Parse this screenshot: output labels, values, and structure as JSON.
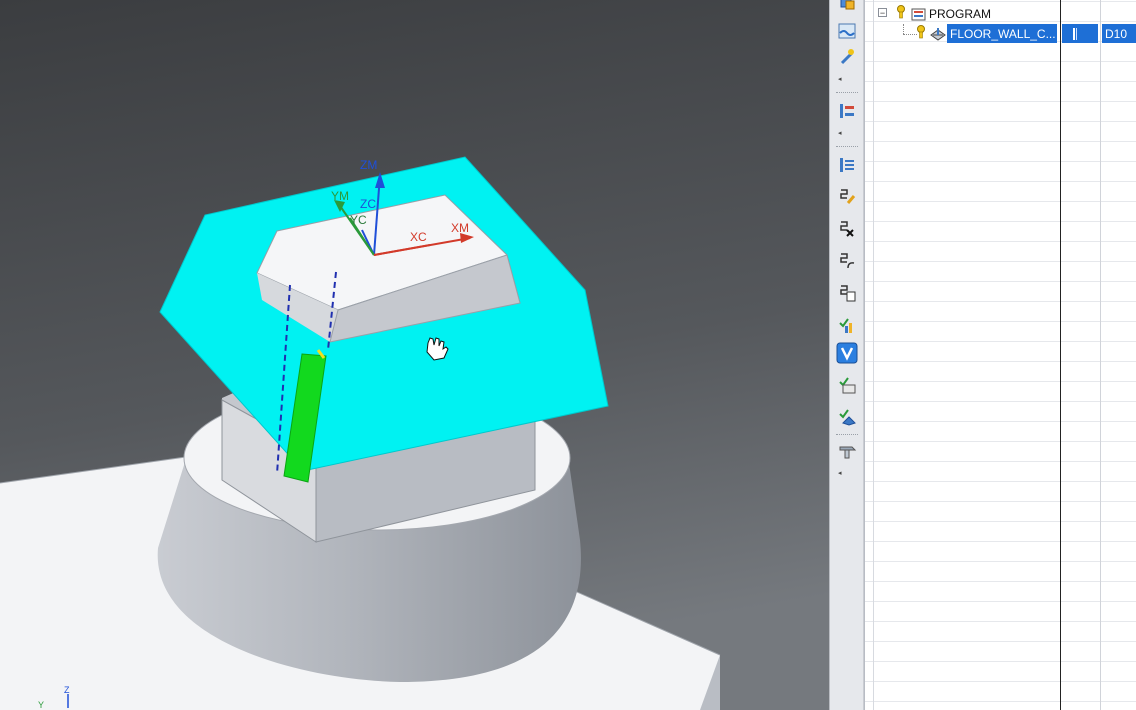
{
  "viewport": {
    "axes": {
      "zm": "ZM",
      "ym": "YM",
      "zc": "ZC",
      "yc": "YC",
      "xc": "XC",
      "xm": "XM",
      "corner_z": "Z",
      "corner_y": "Y"
    },
    "colors": {
      "background_top": "#3e4043",
      "background_bottom": "#6f7378",
      "blank_material": "#00f2f2",
      "tool_path": "#12d91e",
      "part_light": "#f3f4f6",
      "part_mid": "#c7cad0",
      "part_dark": "#8e939b",
      "axis_z": "#1f4fd8",
      "axis_y": "#2a9a3a",
      "axis_x": "#d23a2a"
    }
  },
  "toolbar": {
    "icons": [
      "create-geometry-icon",
      "create-method-icon",
      "create-tool-icon",
      "program-order-icon",
      "machine-tool-icon",
      "edit-operation-icon",
      "delete-operation-icon",
      "generate-toolpath-icon",
      "replay-toolpath-icon",
      "list-toolpath-icon",
      "verify-icon",
      "simulate-machine-icon",
      "postprocess-icon",
      "shop-docs-icon",
      "output-cls-icon"
    ]
  },
  "navigator": {
    "items": [
      {
        "label": "PROGRAM",
        "expanded": true
      },
      {
        "label": "FLOOR_WALL_C...",
        "tool": "D10",
        "selected": true
      }
    ],
    "colors": {
      "selection": "#1e6fd6",
      "warning": "#f0c419",
      "grid": "#e6e8ec"
    }
  }
}
